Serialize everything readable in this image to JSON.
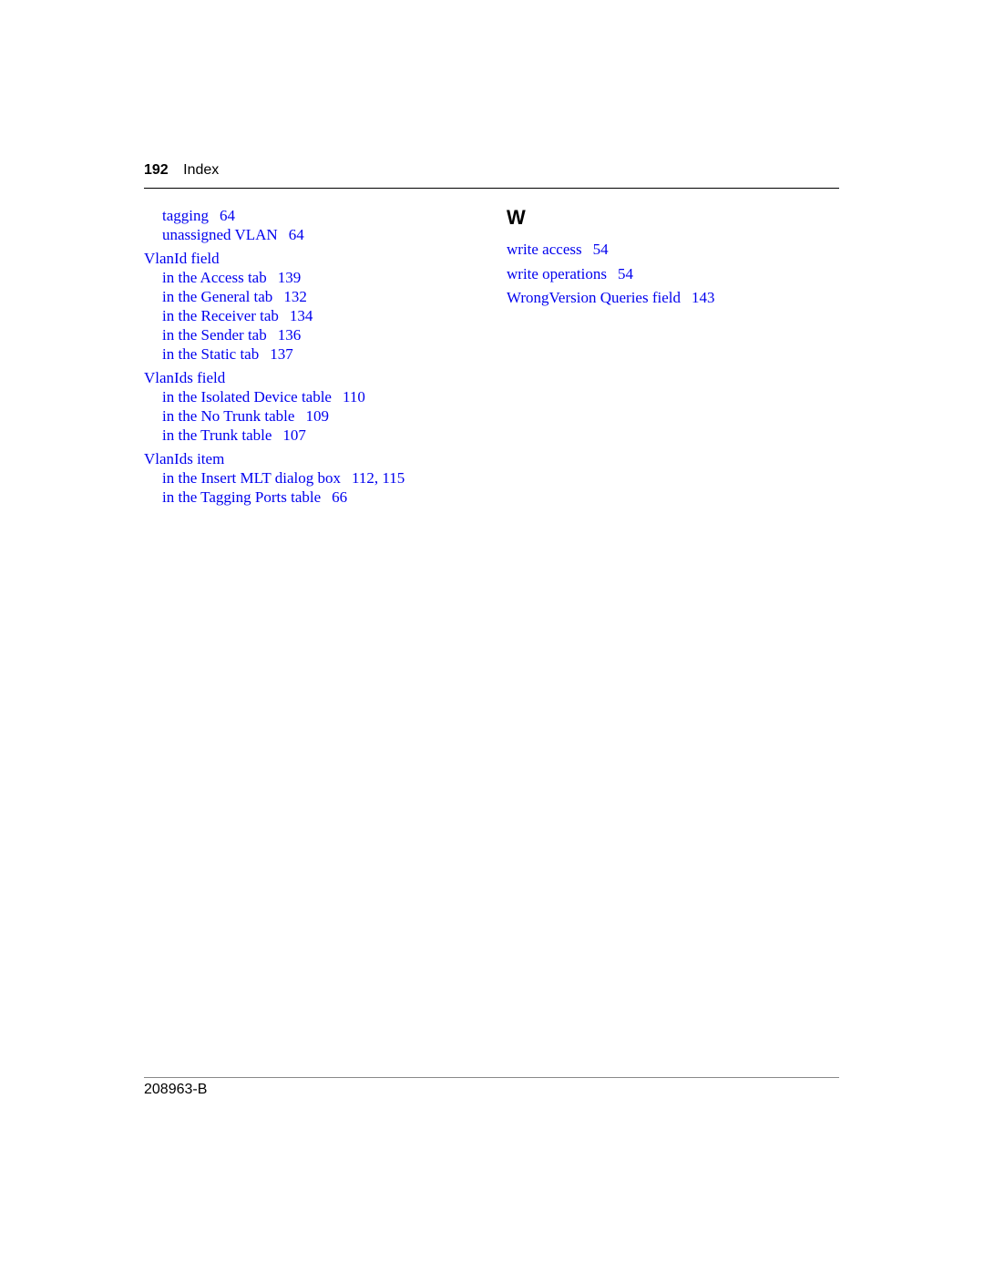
{
  "header": {
    "page_number": "192",
    "section_title": "Index"
  },
  "left_column": {
    "e0": {
      "label": "tagging",
      "pages": "64"
    },
    "e1": {
      "label": "unassigned VLAN",
      "pages": "64"
    },
    "e2": {
      "label": "VlanId field"
    },
    "e3": {
      "label": "in the Access tab",
      "pages": "139"
    },
    "e4": {
      "label": "in the General tab",
      "pages": "132"
    },
    "e5": {
      "label": "in the Receiver tab",
      "pages": "134"
    },
    "e6": {
      "label": "in the Sender tab",
      "pages": "136"
    },
    "e7": {
      "label": "in the Static tab",
      "pages": "137"
    },
    "e8": {
      "label": "VlanIds field"
    },
    "e9": {
      "label": "in the Isolated Device table",
      "pages": "110"
    },
    "e10": {
      "label": "in the No Trunk table",
      "pages": "109"
    },
    "e11": {
      "label": "in the Trunk table",
      "pages": "107"
    },
    "e12": {
      "label": "VlanIds item"
    },
    "e13": {
      "label": "in the Insert MLT dialog box",
      "pages": "112, 115"
    },
    "e14": {
      "label": "in the Tagging Ports table",
      "pages": "66"
    }
  },
  "right_column": {
    "letter": "W",
    "e0": {
      "label": "write access",
      "pages": "54"
    },
    "e1": {
      "label": "write operations",
      "pages": "54"
    },
    "e2": {
      "label": "WrongVersion Queries field",
      "pages": "143"
    }
  },
  "footer": {
    "doc_number": "208963-B"
  },
  "colors": {
    "link": "#0000ee",
    "text": "#000000"
  }
}
